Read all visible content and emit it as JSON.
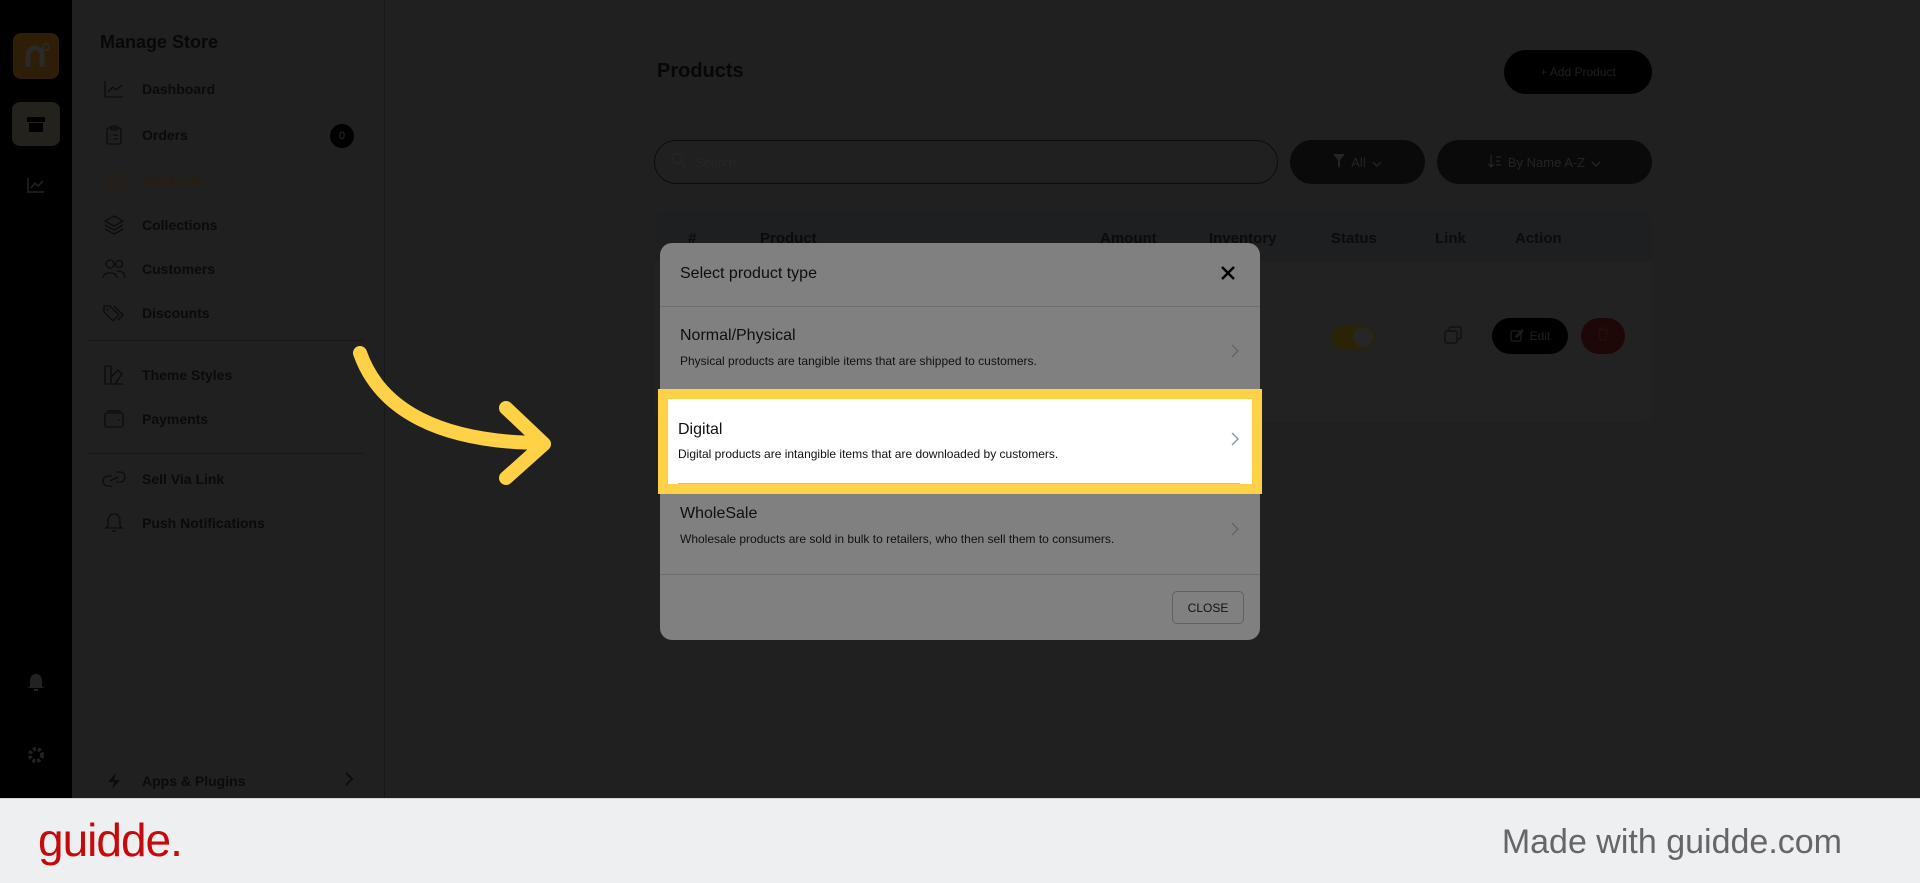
{
  "rail": {
    "logo_letter": "n",
    "icons": [
      "logo-icon",
      "store-icon",
      "analytics-icon",
      "bell-icon",
      "gear-icon"
    ]
  },
  "sidebar": {
    "title": "Manage Store",
    "items": [
      {
        "label": "Dashboard",
        "icon": "chart-line-icon"
      },
      {
        "label": "Orders",
        "icon": "clipboard-icon",
        "badge": "0"
      },
      {
        "label": "Products",
        "icon": "cubes-icon",
        "active": true
      },
      {
        "label": "Collections",
        "icon": "layers-icon"
      },
      {
        "label": "Customers",
        "icon": "users-icon"
      },
      {
        "label": "Discounts",
        "icon": "tags-icon"
      },
      {
        "label": "Theme Styles",
        "icon": "swatch-icon"
      },
      {
        "label": "Payments",
        "icon": "wallet-icon"
      },
      {
        "label": "Sell Via Link",
        "icon": "link-icon"
      },
      {
        "label": "Push Notifications",
        "icon": "bell-icon"
      }
    ],
    "apps": {
      "label": "Apps & Plugins",
      "icon": "bolt-icon"
    }
  },
  "main": {
    "title": "Products",
    "add_button": "+ Add Product",
    "search_placeholder": "Search...",
    "filter_label": "All",
    "sort_label": "By Name A-Z",
    "table": {
      "columns": [
        "#",
        "Product",
        "Amount",
        "Inventory",
        "Status",
        "Link",
        "Action"
      ],
      "row_actions": {
        "edit": "Edit"
      },
      "row_status_enabled": true
    }
  },
  "modal": {
    "title": "Select product type",
    "options": [
      {
        "name": "Normal/Physical",
        "description": "Physical products are tangible items that are shipped to customers."
      },
      {
        "name": "Digital",
        "description": "Digital products are intangible items that are downloaded by customers.",
        "highlighted": true
      },
      {
        "name": "WholeSale",
        "description": "Wholesale products are sold in bulk to retailers, who then sell them to consumers."
      }
    ],
    "close_button": "CLOSE"
  },
  "colors": {
    "highlight": "#ffd146",
    "accent": "#f0a030",
    "guidde_red": "#c40a0a"
  },
  "footer": {
    "logo": "guidde.",
    "made_with": "Made with guidde.com"
  }
}
